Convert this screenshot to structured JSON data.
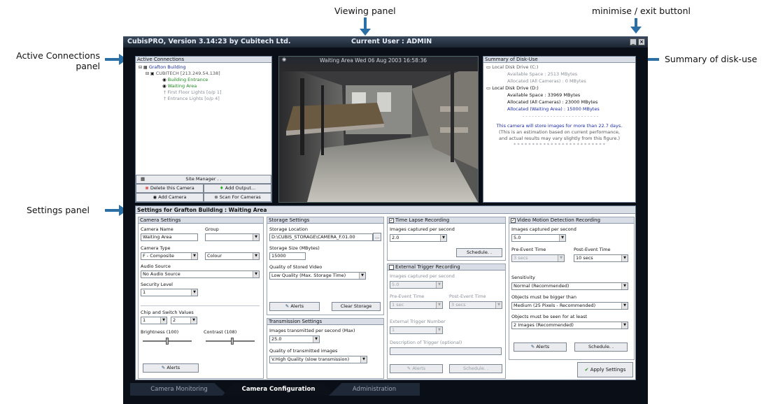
{
  "callouts": {
    "viewing": "Viewing panel",
    "minimise": "minimise / exit buttonl",
    "active_line1": "Active Connections",
    "active_line2": "panel",
    "disk": "Summary of disk-use",
    "settings": "Settings panel"
  },
  "app": {
    "title": "CubisPRO, Version 3.14:23 by Cubitech Ltd.",
    "current_user": "Current User : ADMIN"
  },
  "connections": {
    "header": "Active Connections",
    "tree": [
      {
        "label": "Grafton Building",
        "kind": "building"
      },
      {
        "label": "CUBITECH [213.249.54.138]",
        "kind": "server"
      },
      {
        "label": "Building Entrance",
        "kind": "camera"
      },
      {
        "label": "Waiting Area",
        "kind": "camera"
      },
      {
        "label": "First Floor Lights  [o/p 1]",
        "kind": "output"
      },
      {
        "label": "Entrance Lights  [o/p 4]",
        "kind": "output"
      }
    ],
    "site_manager": "Site Manager . .",
    "delete_camera": "Delete this Camera",
    "add_output": "Add Output...",
    "add_camera": "Add Camera",
    "scan_cameras": "Scan For Cameras"
  },
  "viewer": {
    "caption": "Waiting Area  Wed 06 Aug 2003  16:58:36"
  },
  "disk": {
    "header": "Summary of Disk-Use",
    "c_drive": "Local Disk Drive (C:)",
    "c_available": "Available Space : 2513 MBytes",
    "c_allocated": "Allocated (All Cameras) : 0 MBytes",
    "d_drive": "Local Disk Drive (D:)",
    "d_available": "Available Space : 33969 MBytes",
    "d_allocated_all": "Allocated (All Cameras) : 23000 MBytes",
    "d_allocated_waiting": "Allocated (Waiting Area) : 15000 MBytes",
    "dashes": "- - - - - - - - - - - - - - - - - - - - - - - - -",
    "note1": "This camera will store images for more than 22.7 days.",
    "note2": "(This is an estimation based on current performance,",
    "note3": "and actual results may vary slightly from this figure.)",
    "stars": "* * * * * * * * * * * * * * * * * * * * * * * * *"
  },
  "settings": {
    "header": "Settings for Grafton Building : Waiting Area",
    "camera": {
      "header": "Camera Settings",
      "name_label": "Camera Name",
      "name_value": "Waiting Area",
      "group_label": "Group",
      "group_value": "",
      "type_label": "Camera Type",
      "type_value": "F - Composite",
      "color_value": "Colour",
      "audio_label": "Audio Source",
      "audio_value": "No Audio Source",
      "security_label": "Security Level",
      "security_value": "1",
      "chip_label": "Chip and Switch Values",
      "chip_value": "1",
      "switch_value": "2",
      "brightness_label": "Brightness (100)",
      "contrast_label": "Contrast (108)",
      "brightness": 0.5,
      "contrast": 0.54,
      "alerts": "Alerts"
    },
    "storage": {
      "header": "Storage Settings",
      "location_label": "Storage Location",
      "location_value": "D:\\CUBIS_STORAGE\\CAMERA_F.01.00",
      "browse": "...",
      "size_label": "Storage Size (MBytes)",
      "size_value": "15000",
      "quality_label": "Quality of Stored Video",
      "quality_value": "Low Quality (Max. Storage Time)",
      "alerts": "Alerts",
      "clear": "Clear Storage"
    },
    "transmission": {
      "header": "Transmission Settings",
      "rate_label": "Images transmitted per second (Max)",
      "rate_value": "25.0",
      "quality_label": "Quality of transmitted images",
      "quality_value": "V.High Quality (slow transmission)"
    },
    "timelapse": {
      "header": "Time Lapse Recording",
      "rate_label": "Images captured per second",
      "rate_value": "2.0",
      "schedule": "Schedule. ."
    },
    "external": {
      "header": "External Trigger Recording",
      "rate_label": "Images captured per second",
      "rate_value": "5.0",
      "pre_label": "Pre-Event Time",
      "pre_value": "1 sec",
      "post_label": "Post-Event Time",
      "post_value": "3 secs",
      "number_label": "External Trigger Number",
      "number_value": "1",
      "desc_label": "Description of Trigger (optional)",
      "desc_value": "",
      "alerts": "Alerts",
      "schedule": "Schedule. ."
    },
    "motion": {
      "header": "Video Motion Detection Recording",
      "rate_label": "Images captured per second",
      "rate_value": "5.0",
      "pre_label": "Pre-Event Time",
      "pre_value": "3 secs",
      "post_label": "Post-Event Time",
      "post_value": "10 secs",
      "sensitivity_label": "Sensitivity",
      "sensitivity_value": "Normal (Recommended)",
      "bigger_label": "Objects must be bigger than",
      "bigger_value": "Medium (25 Pixels - Recommended)",
      "seen_label": "Objects must be seen for at least",
      "seen_value": "2 Images (Recommended)",
      "alerts": "Alerts",
      "schedule": "Schedule. ."
    },
    "apply": "Apply Settings"
  },
  "tabs": [
    "Camera Monitoring",
    "Camera Configuration",
    "Administration"
  ]
}
